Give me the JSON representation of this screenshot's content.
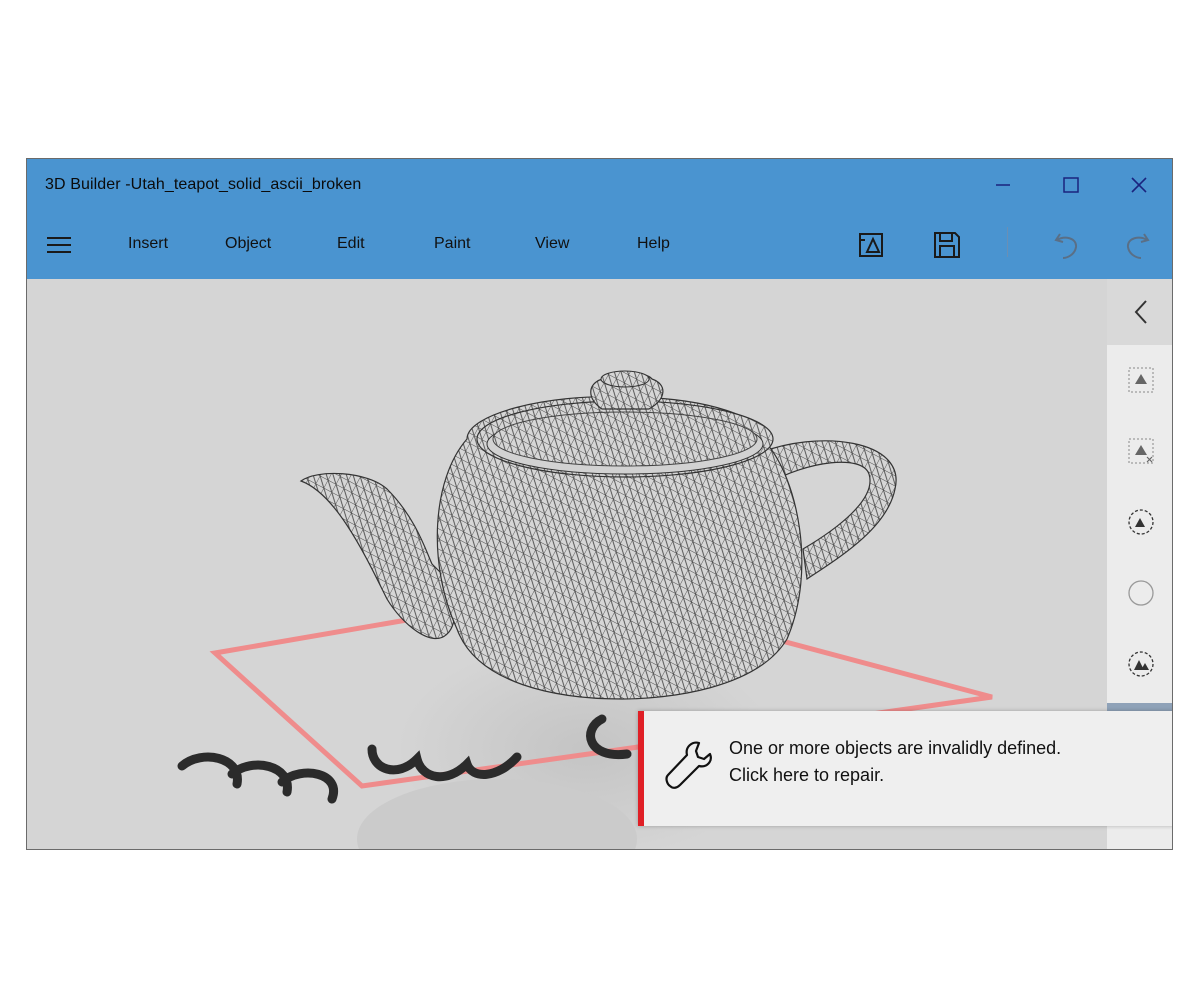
{
  "window": {
    "title": "3D Builder -Utah_teapot_solid_ascii_broken",
    "controls": {
      "minimize": "minimize-icon",
      "maximize": "maximize-icon",
      "close": "close-icon"
    }
  },
  "menu": {
    "items": [
      {
        "label": "Insert"
      },
      {
        "label": "Object"
      },
      {
        "label": "Edit"
      },
      {
        "label": "Paint"
      },
      {
        "label": "View"
      },
      {
        "label": "Help"
      }
    ]
  },
  "toolbar": {
    "icons": [
      "print-3d-icon",
      "save-icon",
      "undo-icon",
      "redo-icon"
    ]
  },
  "sidebar": {
    "icons": [
      "chevron-left-icon",
      "duplicate-icon",
      "delete-object-icon",
      "settle-icon",
      "circle-icon",
      "material-icon"
    ]
  },
  "notification": {
    "line1": "One or more objects are invalidly defined.",
    "line2": "Click here to repair.",
    "icon": "wrench-icon",
    "accent_color": "#e01f26"
  },
  "colors": {
    "title_bar": "#4a94d0",
    "viewport_bg": "#d5d5d5",
    "build_plate_outline": "#ef8c8c"
  }
}
